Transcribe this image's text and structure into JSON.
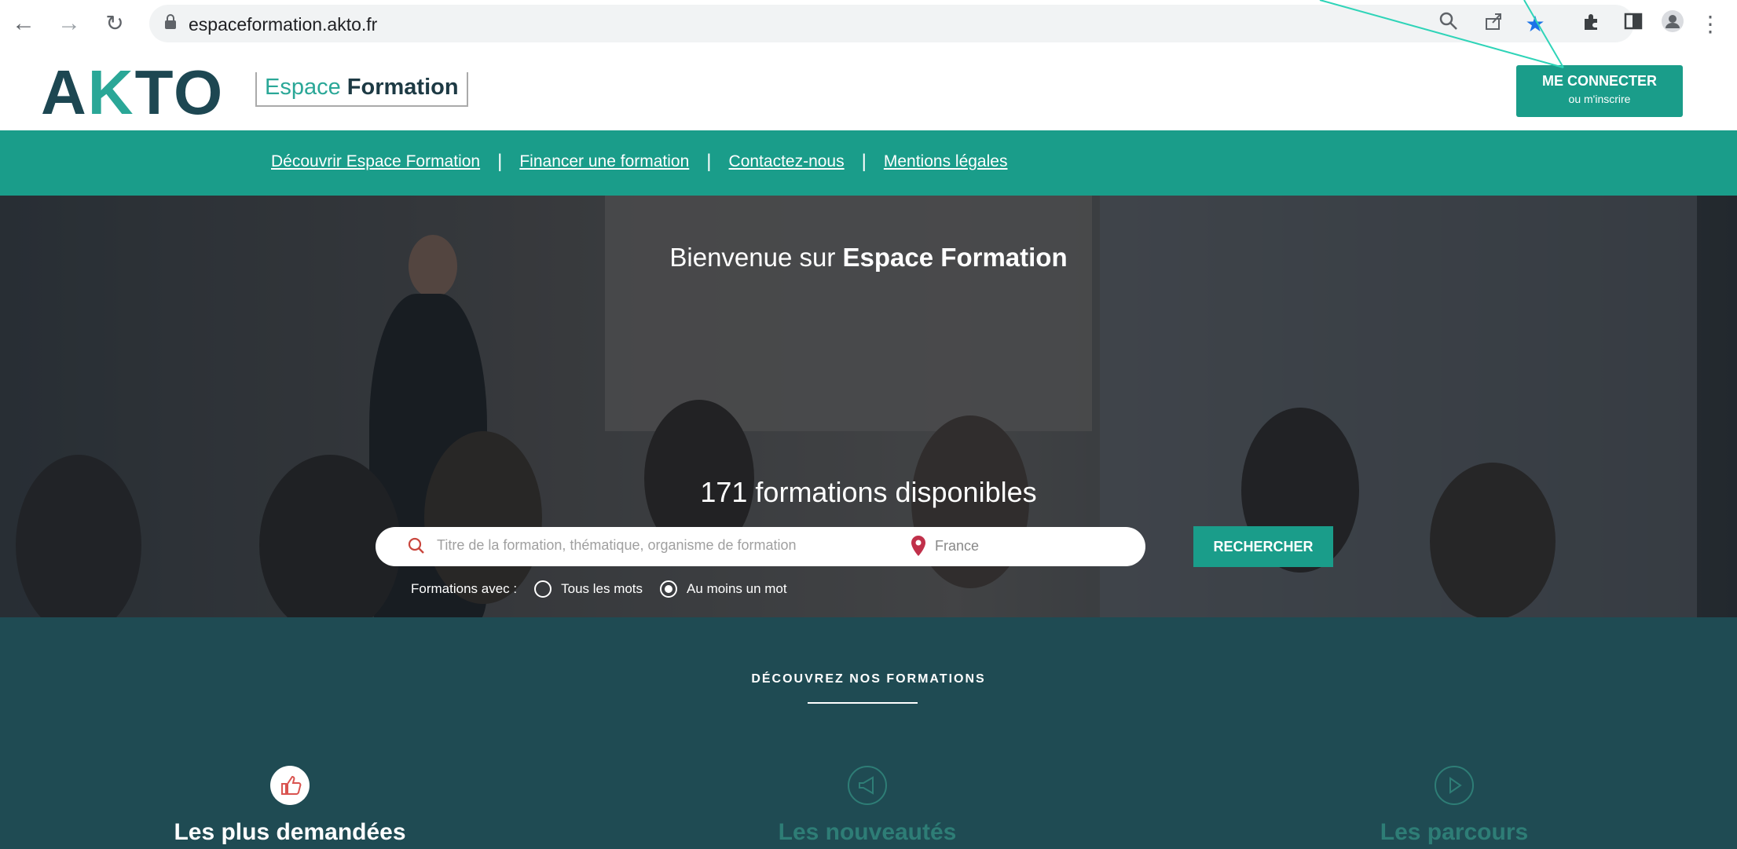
{
  "browser": {
    "url": "espaceformation.akto.fr",
    "nav_icons": [
      "back-icon",
      "forward-icon",
      "reload-icon"
    ],
    "toolbar_icons": [
      "zoom-icon",
      "share-icon",
      "star-icon",
      "extensions-icon",
      "sidepanel-icon",
      "profile-icon",
      "menu-icon"
    ]
  },
  "header": {
    "logo": "AKTO",
    "espace_light": "Espace",
    "espace_bold": "Formation",
    "connect_main": "ME CONNECTER",
    "connect_sub": "ou m'inscrire"
  },
  "nav": {
    "items": [
      "Découvrir Espace Formation",
      "Financer une formation",
      "Contactez-nous",
      "Mentions légales"
    ],
    "separator": "|"
  },
  "hero": {
    "welcome_prefix": "Bienvenue sur",
    "welcome_bold": "Espace Formation",
    "count": "171 formations disponibles",
    "search_placeholder": "Titre de la formation, thématique, organisme de formation",
    "location": "France",
    "search_button": "RECHERCHER",
    "options_label": "Formations avec :",
    "option_all": "Tous les mots",
    "option_any": "Au moins un mot"
  },
  "discover": {
    "title": "DÉCOUVREZ NOS FORMATIONS",
    "categories": [
      {
        "label": "Les plus demandées",
        "icon": "thumbs-up-icon"
      },
      {
        "label": "Les nouveautés",
        "icon": "megaphone-icon"
      },
      {
        "label": "Les parcours",
        "icon": "play-icon"
      }
    ]
  },
  "colors": {
    "brand_teal": "#1a9d8a",
    "dark_teal": "#1f4b53",
    "logo_dark": "#1d4752",
    "muted_teal_text": "#2e7d76"
  }
}
